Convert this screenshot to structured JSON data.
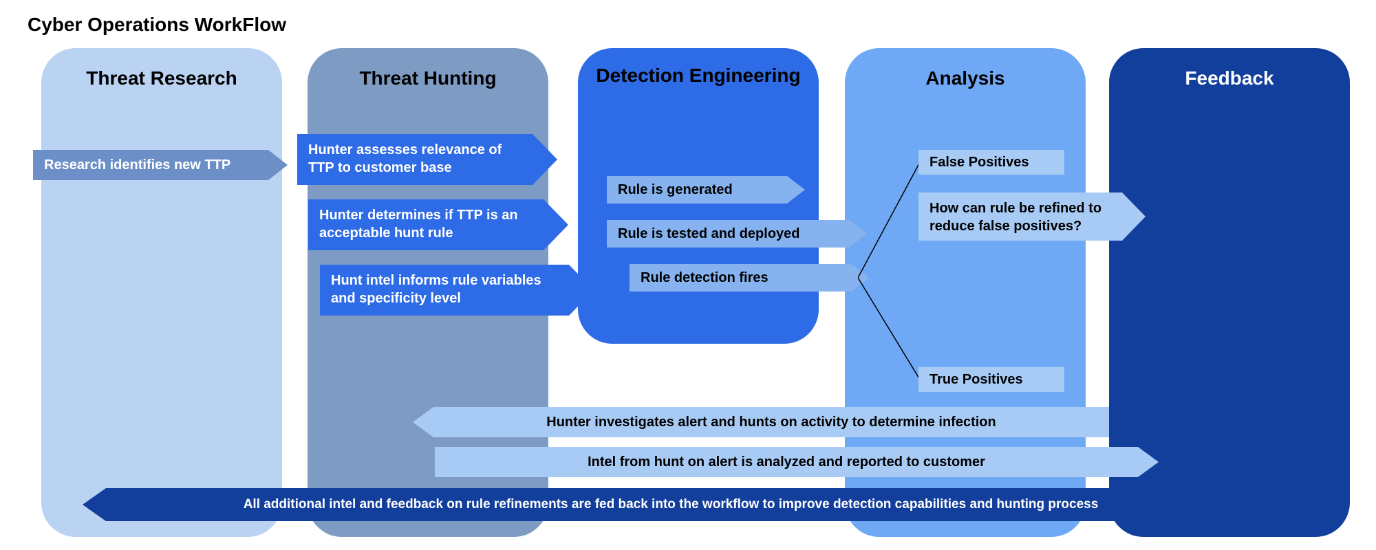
{
  "title": "Cyber Operations WorkFlow",
  "columns": {
    "research": {
      "header": "Threat Research"
    },
    "hunting": {
      "header": "Threat Hunting"
    },
    "detection": {
      "header": "Detection Engineering"
    },
    "analysis": {
      "header": "Analysis"
    },
    "feedback": {
      "header": "Feedback"
    }
  },
  "steps": {
    "research_ttp": "Research identifies new TTP",
    "hunter_relevance": "Hunter assesses relevance of TTP to customer base",
    "hunter_acceptable": "Hunter determines if TTP is an acceptable hunt rule",
    "hunt_intel": "Hunt intel informs rule variables and specificity level",
    "rule_generated": "Rule is generated",
    "rule_tested": "Rule is tested and deployed",
    "rule_fires": "Rule detection fires",
    "false_positives": "False Positives",
    "refine_rule": "How can rule be refined to reduce false positives?",
    "true_positives": "True Positives",
    "hunter_investigates": "Hunter investigates alert and hunts on activity to determine infection",
    "intel_analyzed": "Intel from hunt on alert is analyzed and reported to customer",
    "feedback_loop": "All additional intel and feedback on rule refinements are fed back into the workflow to improve detection capabilities and hunting process"
  },
  "colors": {
    "col_research": "#BBD3F2",
    "col_hunting": "#7E9BC4",
    "col_detection": "#2E6BE6",
    "col_analysis": "#6FA8F5",
    "col_feedback": "#123E9C",
    "arrow_research": "#6B8FC6",
    "arrow_hunt": "#2E6BE6",
    "arrow_det": "#86B3F0",
    "arrow_ana": "#A8CBF5",
    "arrow_long1": "#A8CBF5",
    "arrow_long2": "#A8CBF5",
    "arrow_loop": "#123E9C"
  }
}
